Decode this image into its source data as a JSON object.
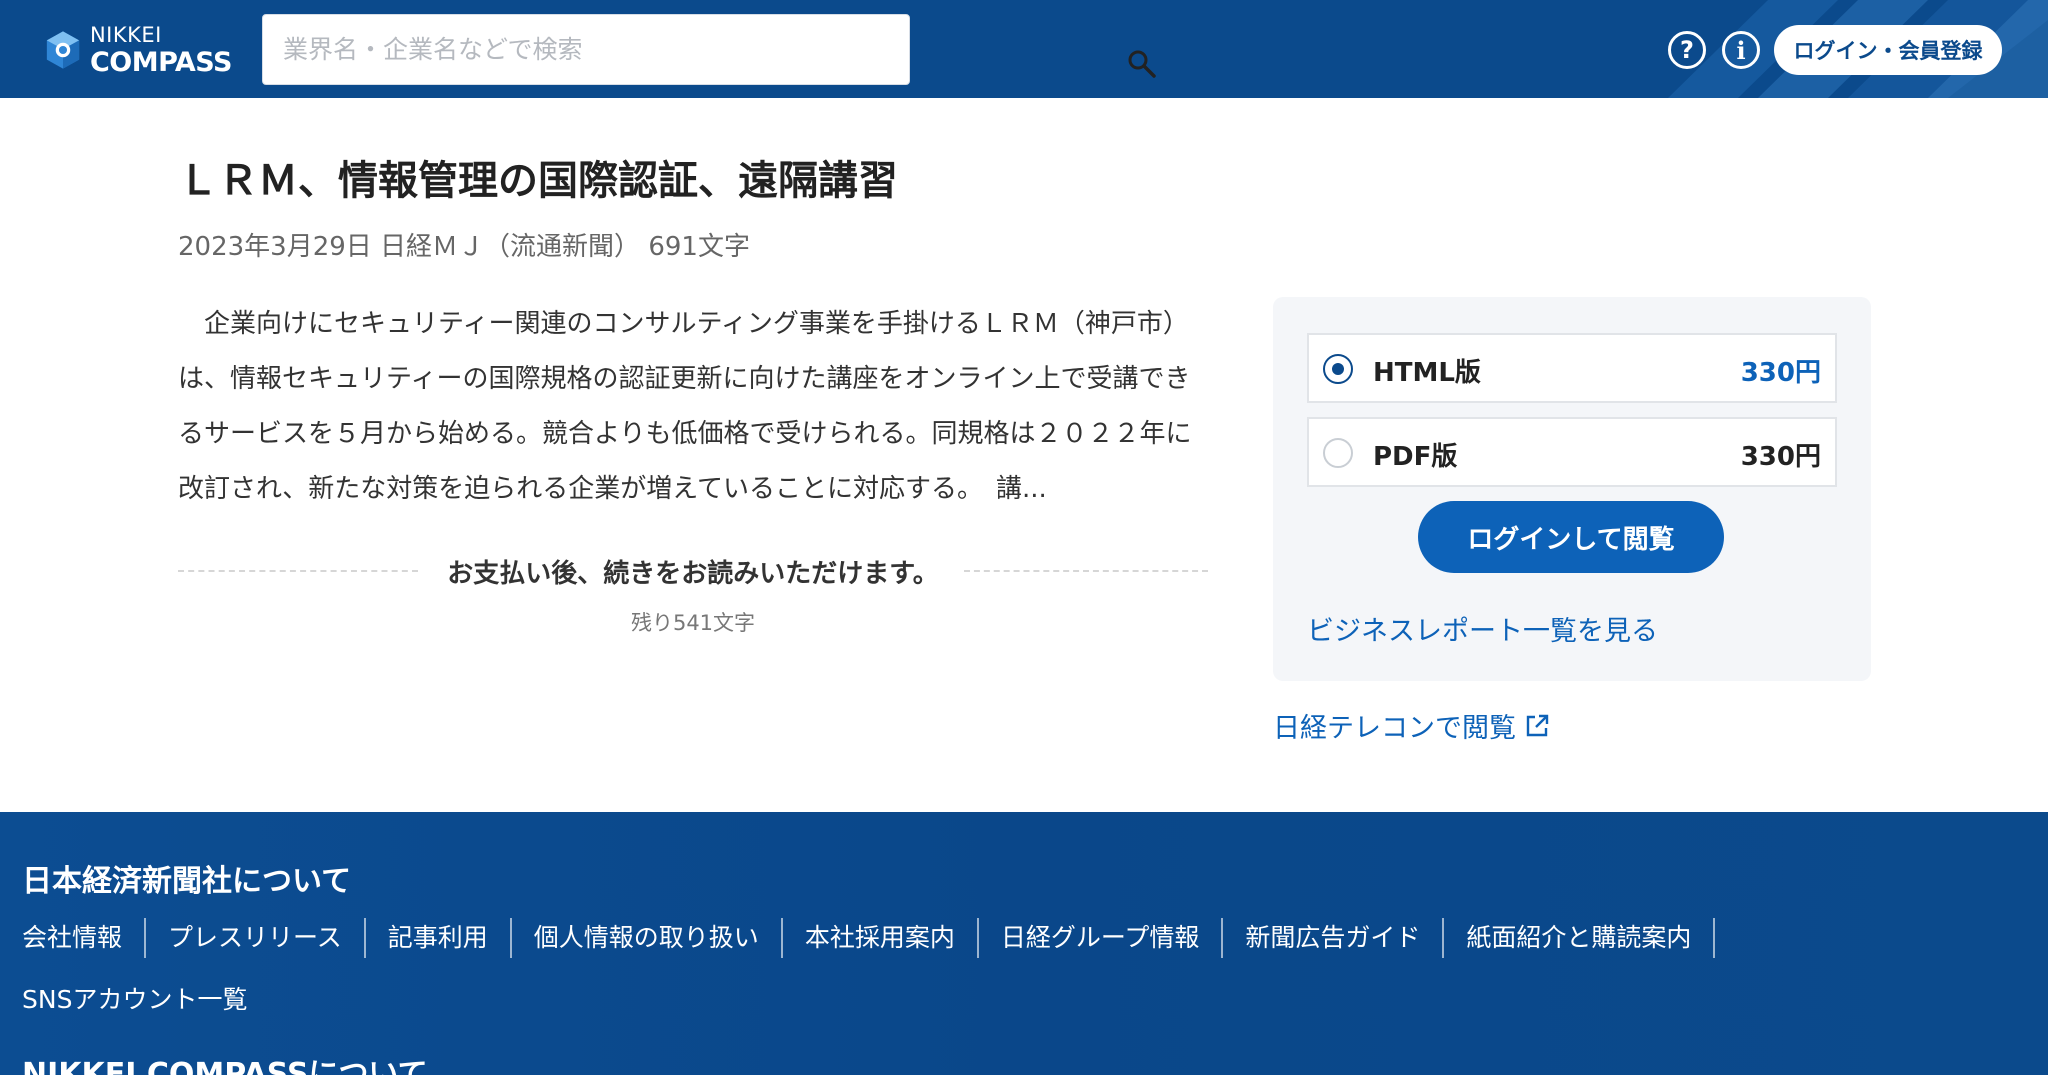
{
  "header": {
    "logo_line1": "NIKKEI",
    "logo_line2": "COMPASS",
    "search_placeholder": "業界名・企業名などで検索",
    "help_glyph": "?",
    "info_glyph": "i",
    "login_label": "ログイン・会員登録"
  },
  "article": {
    "title": "ＬＲＭ、情報管理の国際認証、遠隔講習",
    "meta": "2023年3月29日 日経ＭＪ（流通新聞） 691文字",
    "body": "企業向けにセキュリティー関連のコンサルティング事業を手掛けるＬＲＭ（神戸市）は、情報セキュリティーの国際規格の認証更新に向けた講座をオンライン上で受講できるサービスを５月から始める。競合よりも低価格で受けられる。同規格は２０２２年に改訂され、新たな対策を迫られる企業が増えていることに対応する。　講...",
    "paywall_message": "お支払い後、続きをお読みいただけます。",
    "remaining": "残り541文字"
  },
  "purchase": {
    "options": [
      {
        "name": "HTML版",
        "price": "330円",
        "selected": true
      },
      {
        "name": "PDF版",
        "price": "330円",
        "selected": false
      }
    ],
    "read_button": "ログインして閲覧",
    "business_report_link": "ビジネスレポート一覧を見る",
    "telecom_link": "日経テレコンで閲覧"
  },
  "footer": {
    "title": "日本経済新聞社について",
    "links": [
      "会社情報",
      "プレスリリース",
      "記事利用",
      "個人情報の取り扱い",
      "本社採用案内",
      "日経グループ情報",
      "新聞広告ガイド",
      "紙面紹介と購読案内"
    ],
    "sns": "SNSアカウント一覧",
    "next_section": "NIKKEI COMPASSについて"
  },
  "colors": {
    "header_bg": "#0b4a8c",
    "accent": "#0d62b8",
    "panel_bg": "#f4f6f9"
  }
}
